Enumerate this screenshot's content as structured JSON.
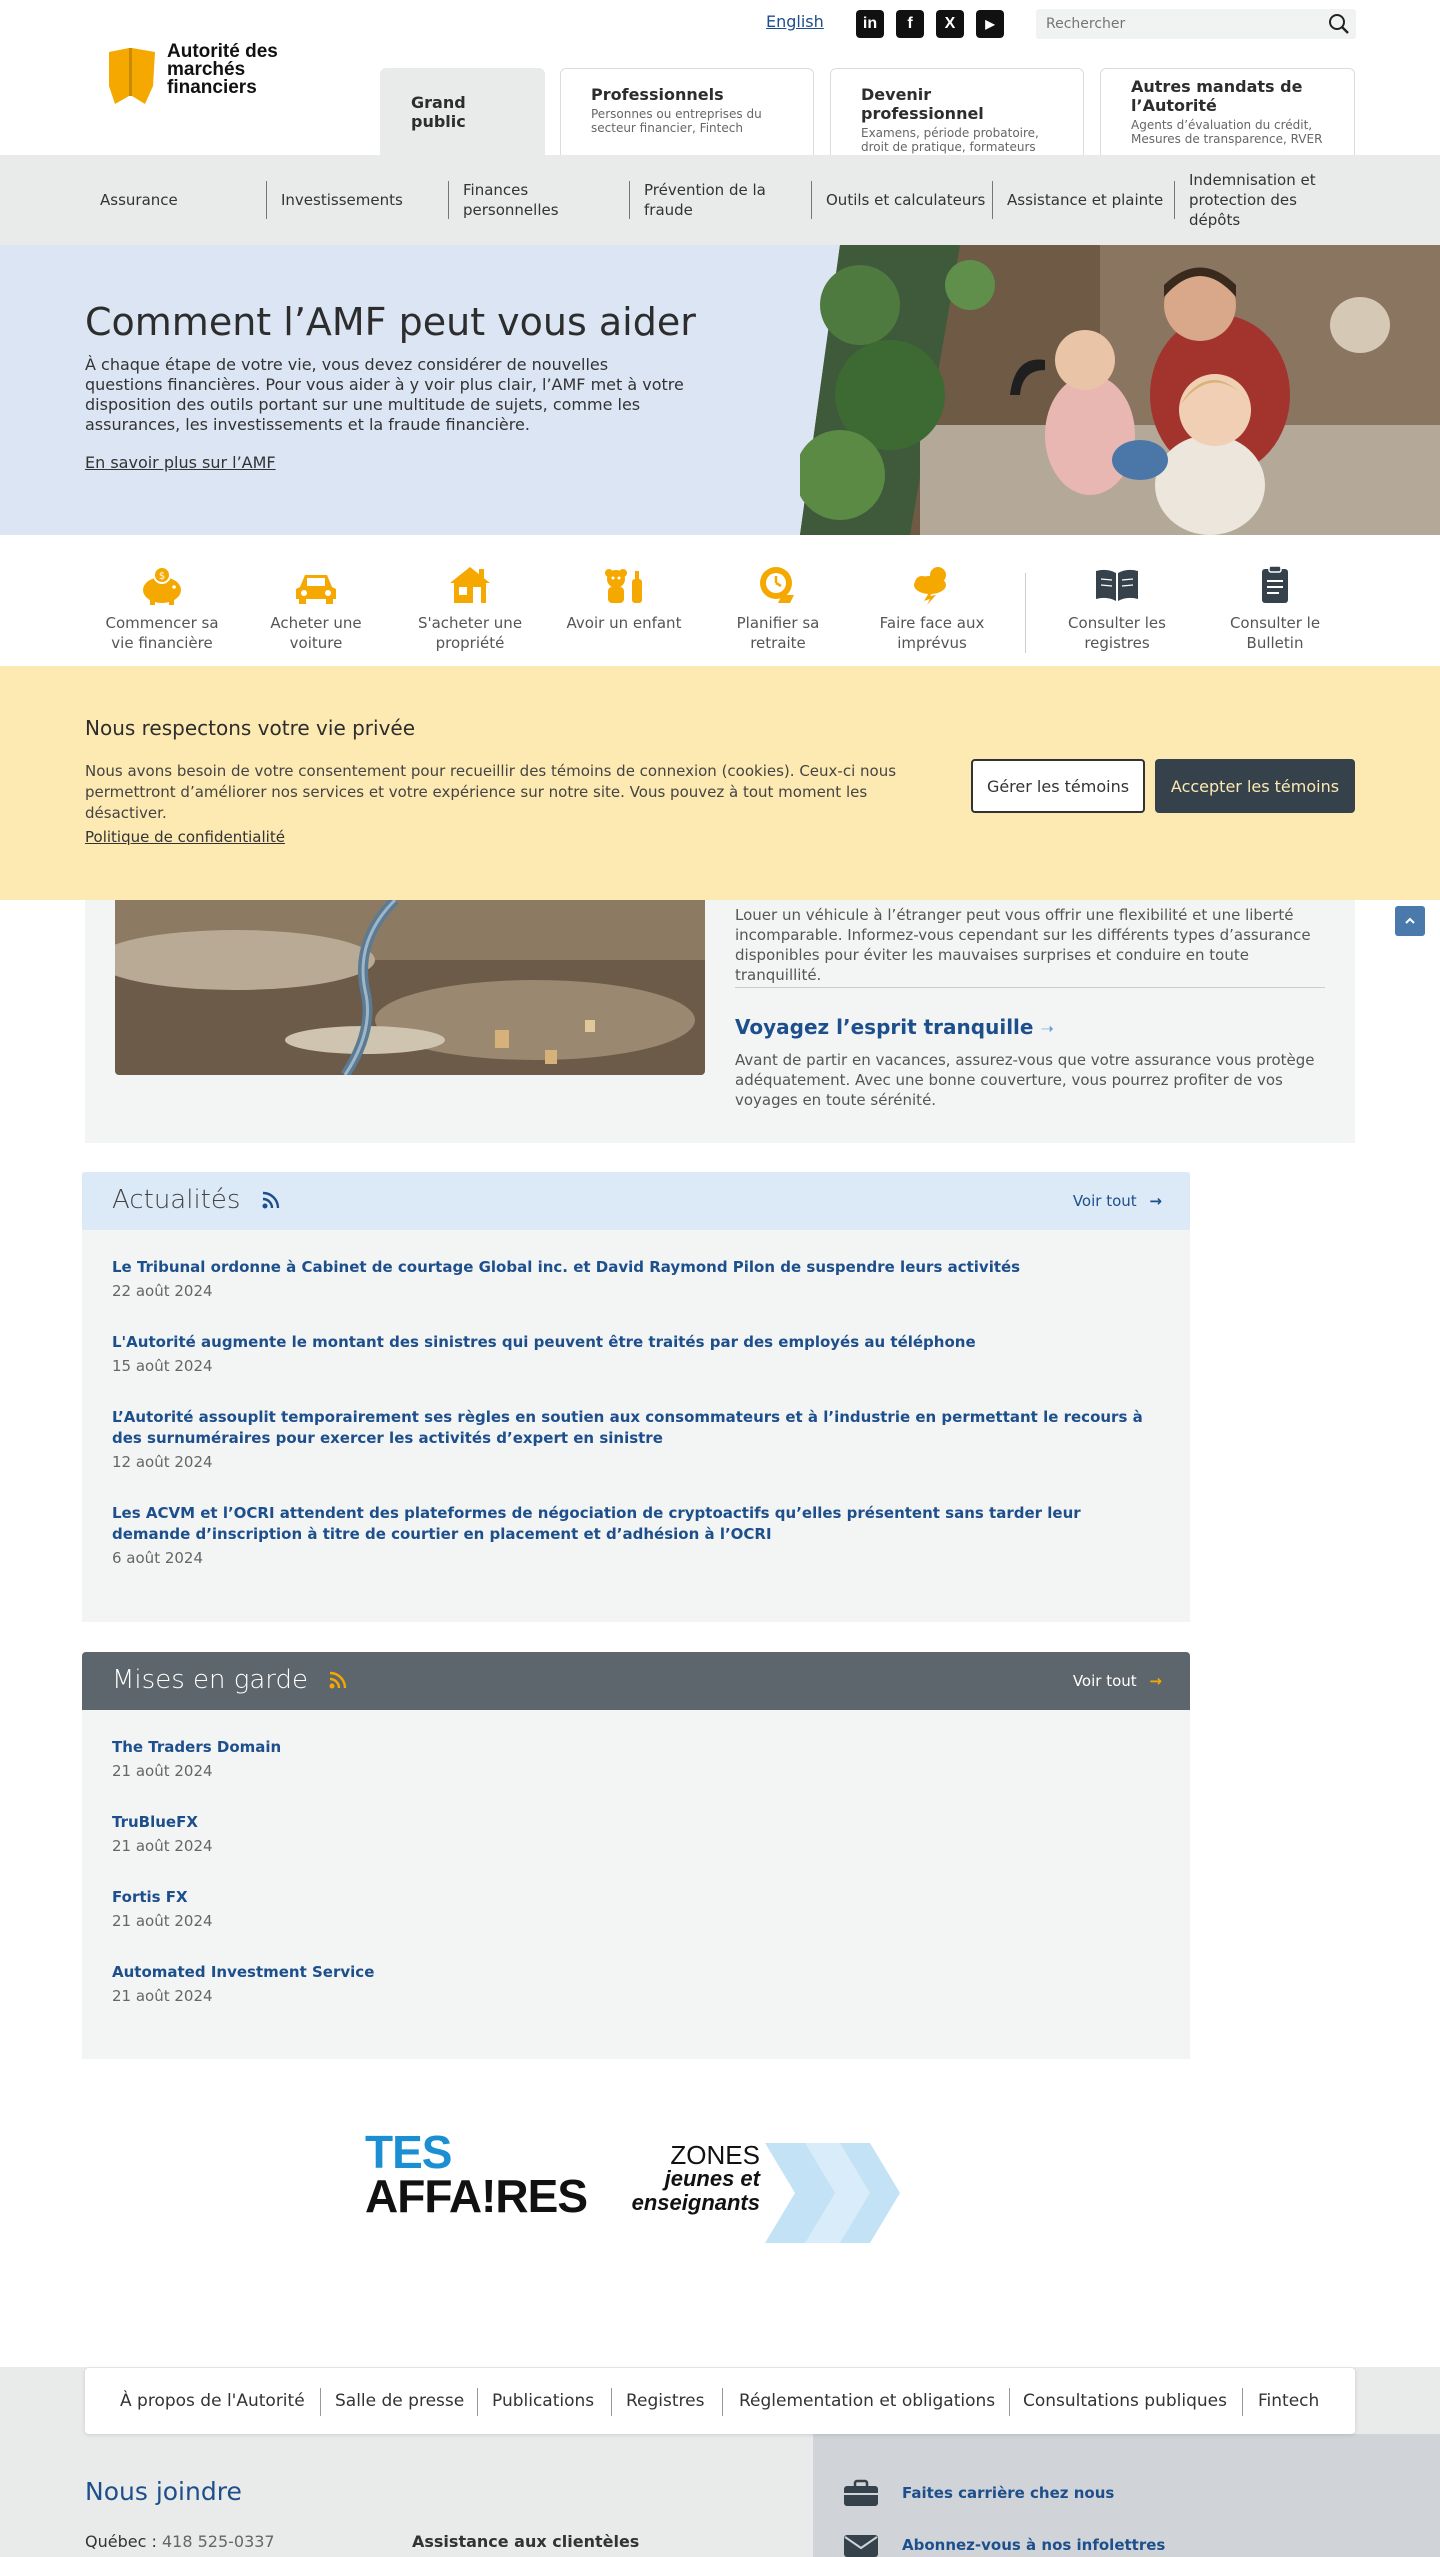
{
  "header": {
    "logo_text": "Autorité des marchés financiers",
    "lang": "English",
    "social": [
      "in",
      "f",
      "X",
      "▶"
    ],
    "search_placeholder": "Rechercher",
    "audiences": [
      {
        "title": "Grand public",
        "sub": ""
      },
      {
        "title": "Professionnels",
        "sub": "Personnes ou entreprises du secteur financier, Fintech"
      },
      {
        "title": "Devenir professionnel",
        "sub": "Examens, période probatoire, droit de pratique, formateurs"
      },
      {
        "title": "Autres mandats de l’Autorité",
        "sub": "Agents d’évaluation du crédit, Mesures de transparence, RVER"
      }
    ]
  },
  "nav": {
    "items": [
      "Assurance",
      "Investissements",
      "Finances personnelles",
      "Prévention de la fraude",
      "Outils et calculateurs",
      "Assistance et plainte",
      "Indemnisation et protection des dépôts"
    ]
  },
  "hero": {
    "title": "Comment l’AMF peut vous aider",
    "text": "À chaque étape de votre vie, vous devez considérer de nouvelles questions financières. Pour vous aider à y voir plus clair, l’AMF met à votre disposition des outils portant sur une multitude de sujets, comme les assurances, les investissements et la fraude financière.",
    "link": "En savoir plus sur l’AMF"
  },
  "quick": {
    "items": [
      "Commencer sa vie financière",
      "Acheter une voiture",
      "S'acheter une propriété",
      "Avoir un enfant",
      "Planifier sa retraite",
      "Faire face aux imprévus",
      "Consulter les registres",
      "Consulter le Bulletin"
    ],
    "icons": [
      "piggy-bank-icon",
      "car-icon",
      "house-icon",
      "baby-icon",
      "clock-money-icon",
      "storm-cloud-icon",
      "open-book-icon",
      "bulletin-icon"
    ],
    "accent": "#f5a800"
  },
  "privacy": {
    "title": "Nous respectons votre vie privée",
    "text": "Nous avons besoin de votre consentement pour recueillir des témoins de connexion (cookies). Ceux-ci nous permettront d’améliorer nos services et votre expérience sur notre site. Vous pouvez à tout moment les désactiver.",
    "link": "Politique de confidentialité",
    "manage": "Gérer les témoins",
    "accept": "Accepter les témoins"
  },
  "feature": {
    "text1": "Louer un véhicule à l’étranger peut vous offrir une flexibilité et une liberté incomparable. Informez-vous cependant sur les différents types d’assurance disponibles pour éviter les mauvaises surprises et conduire en toute tranquillité.",
    "title2": "Voyagez l’esprit tranquille",
    "text2": "Avant de partir en vacances, assurez-vous que votre assurance vous protège adéquatement. Avec une bonne couverture, vous pourrez profiter de vos voyages en toute sérénité."
  },
  "news": {
    "title": "Actualités",
    "see_all": "Voir tout",
    "items": [
      {
        "title": "Le Tribunal ordonne à Cabinet de courtage Global inc. et David Raymond Pilon de suspendre leurs activités",
        "date": "22 août 2024"
      },
      {
        "title": "L'Autorité augmente le montant des sinistres qui peuvent être traités par des employés au téléphone",
        "date": "15 août 2024"
      },
      {
        "title": "L’Autorité assouplit temporairement ses règles en soutien aux consommateurs et à l’industrie en permettant le recours à des surnuméraires pour exercer les activités d’expert en sinistre",
        "date": "12 août 2024"
      },
      {
        "title": "Les ACVM et l’OCRI attendent des plateformes de négociation de cryptoactifs qu’elles présentent sans tarder leur demande d’inscription à titre de courtier en placement et d’adhésion à l’OCRI",
        "date": "6 août 2024"
      }
    ]
  },
  "warnings": {
    "title": "Mises en garde",
    "see_all": "Voir tout",
    "items": [
      {
        "title": "The Traders Domain",
        "date": "21 août 2024"
      },
      {
        "title": "TruBlueFX",
        "date": "21 août 2024"
      },
      {
        "title": "Fortis FX",
        "date": "21 août 2024"
      },
      {
        "title": "Automated Investment Service",
        "date": "21 août 2024"
      }
    ]
  },
  "promo": {
    "tes_line1": "TES",
    "tes_line2": "AFFA!RES",
    "zones_line1": "ZONES",
    "zones_line2": "jeunes et",
    "zones_line3": "enseignants"
  },
  "footer": {
    "nav": [
      "À propos de l'Autorité",
      "Salle de presse",
      "Publications",
      "Registres",
      "Réglementation et obligations",
      "Consultations publiques",
      "Fintech"
    ],
    "contact_title": "Nous joindre",
    "city": "Québec :",
    "phone": "418 525-0337",
    "assist": "Assistance aux clientèles",
    "careers": "Faites carrière chez nous",
    "newsletter": "Abonnez-vous à nos infolettres"
  },
  "colors": {
    "brand_yellow": "#f5a800",
    "link_blue": "#1d4f8c",
    "hero_bg": "#dce5f3",
    "privacy_bg": "#fde9b2",
    "dark_btn": "#35424b",
    "warning_header": "#5d666d"
  }
}
